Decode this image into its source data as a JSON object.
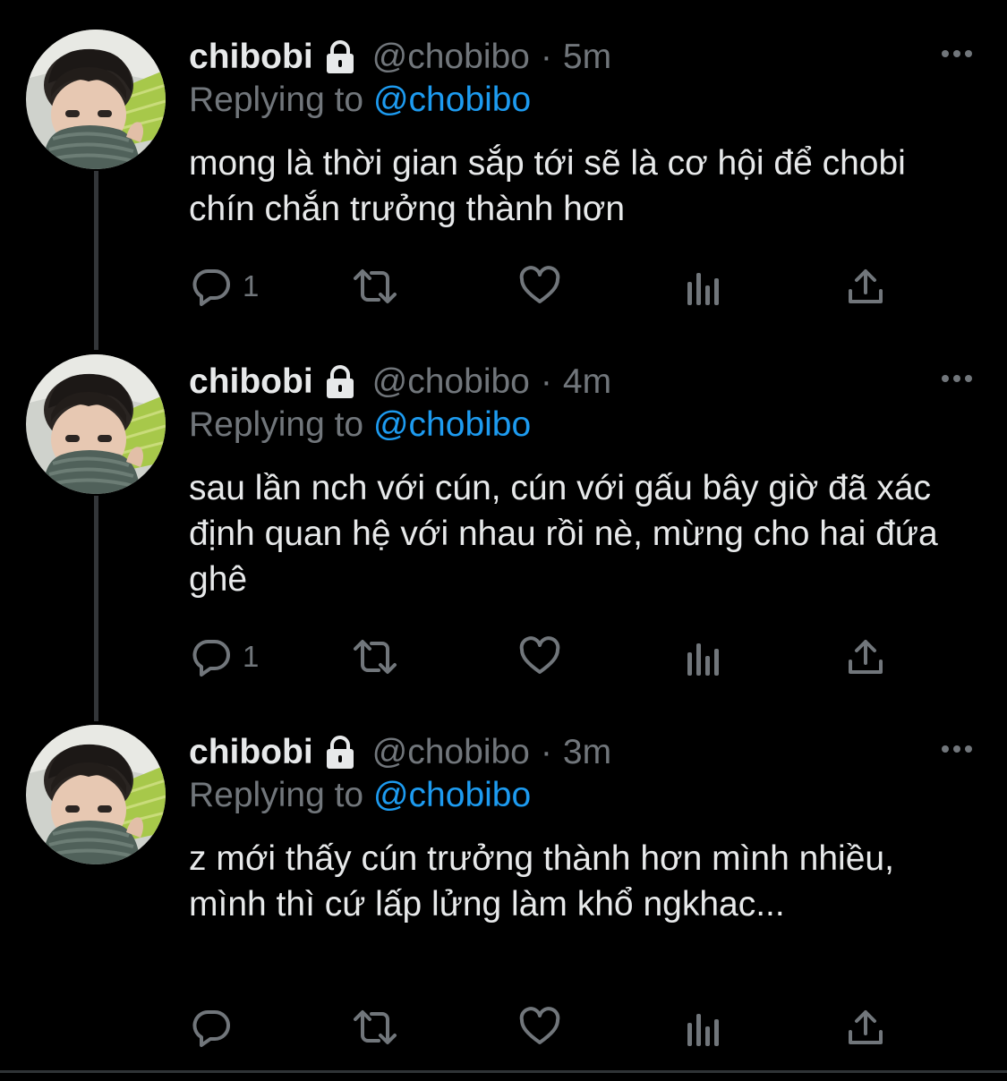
{
  "colors": {
    "background": "#000000",
    "primary_text": "#e7e9ea",
    "secondary_text": "#71767b",
    "link": "#1d9bf0",
    "thread_line": "#333639"
  },
  "tweets": [
    {
      "display_name": "chibobi",
      "protected_icon": "lock-icon",
      "handle": "@chobibo",
      "separator": "·",
      "time": "5m",
      "replying_prefix": "Replying to",
      "replying_handle": "@chobibo",
      "text": "mong là thời gian sắp tới sẽ là cơ hội để chobi chín chắn trưởng thành hơn",
      "reply_count": "1",
      "icons": [
        "reply-icon",
        "retweet-icon",
        "like-icon",
        "analytics-icon",
        "share-icon",
        "more-icon"
      ]
    },
    {
      "display_name": "chibobi",
      "protected_icon": "lock-icon",
      "handle": "@chobibo",
      "separator": "·",
      "time": "4m",
      "replying_prefix": "Replying to",
      "replying_handle": "@chobibo",
      "text": "sau lần nch với cún, cún với gấu bây giờ đã xác định quan hệ với nhau rồi nè, mừng cho hai đứa ghê",
      "reply_count": "1",
      "icons": [
        "reply-icon",
        "retweet-icon",
        "like-icon",
        "analytics-icon",
        "share-icon",
        "more-icon"
      ]
    },
    {
      "display_name": "chibobi",
      "protected_icon": "lock-icon",
      "handle": "@chobibo",
      "separator": "·",
      "time": "3m",
      "replying_prefix": "Replying to",
      "replying_handle": "@chobibo",
      "text": "z mới thấy cún trưởng thành hơn mình nhiều, mình thì cứ lấp lửng làm khổ ngkhac...",
      "reply_count": "",
      "icons": [
        "reply-icon",
        "retweet-icon",
        "like-icon",
        "analytics-icon",
        "share-icon",
        "more-icon"
      ]
    }
  ]
}
